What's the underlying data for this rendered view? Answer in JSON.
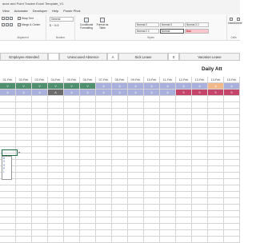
{
  "window": {
    "title": "ance and Point Tracker Excel Template_V1"
  },
  "menu": [
    "View",
    "Automate",
    "Developer",
    "Help",
    "Power Pivot"
  ],
  "ribbon": {
    "wrap_text": "Wrap Text",
    "merge_center": "Merge & Center",
    "font_format": "General",
    "number_symbols": "$ ~ % 9",
    "alignment_label": "Alignment",
    "number_label": "Number",
    "styles_label": "Styles",
    "cells_label": "Cells",
    "conditional_formatting": "Conditional Formatting",
    "format_as_table": "Format as Table",
    "styles": [
      "Normal 2",
      "Normal 2 2",
      "Normal 3",
      "Normal 3 2",
      "Normal",
      "Bad"
    ],
    "insert": "Insert",
    "delete": "Delete",
    "format": "Fo"
  },
  "legend": {
    "attended": "Employee Attended",
    "attended_code": "",
    "unexcused": "Unexcused Absence",
    "unexcused_code": "A",
    "sick": "Sick Leave",
    "sick_code": "S",
    "vacation": "Vacation Leave"
  },
  "daily_title": "Daily Att",
  "dates": [
    "01-Feb",
    "02-Feb",
    "03-Feb",
    "04-Feb",
    "05-Feb",
    "06-Feb",
    "07-Feb",
    "08-Feb",
    "09-Feb",
    "10-Feb",
    "11-Feb",
    "12-Feb",
    "13-Feb",
    "14-Feb",
    "15-Feb"
  ],
  "rows": [
    {
      "vals": [
        "V",
        "V",
        "V",
        "V",
        "V",
        "V",
        "A",
        "A",
        "A",
        "A",
        "A",
        "A",
        "A",
        "A",
        "A"
      ],
      "cls": [
        "g",
        "g",
        "g",
        "g",
        "g",
        "g",
        "l",
        "l",
        "l",
        "l",
        "l",
        "l",
        "l",
        "o",
        "l"
      ]
    },
    {
      "vals": [
        "A",
        "A",
        "A",
        "A",
        "A",
        "A",
        "A",
        "A",
        "A",
        "A",
        "A",
        "S",
        "S",
        "S",
        "S"
      ],
      "cls": [
        "l",
        "l",
        "l",
        "d",
        "l",
        "l",
        "l",
        "l",
        "l",
        "l",
        "l",
        "p",
        "p",
        "p",
        "p"
      ]
    }
  ],
  "dropdown_options": [
    "A",
    "V",
    "S",
    "P",
    "L"
  ],
  "colors": {
    "accent": "#1e6c3d",
    "green": "#4f8f6f",
    "lavender": "#aab0dc",
    "pink": "#c4446a",
    "orange": "#f1b98b",
    "dark": "#6b6b6b"
  }
}
